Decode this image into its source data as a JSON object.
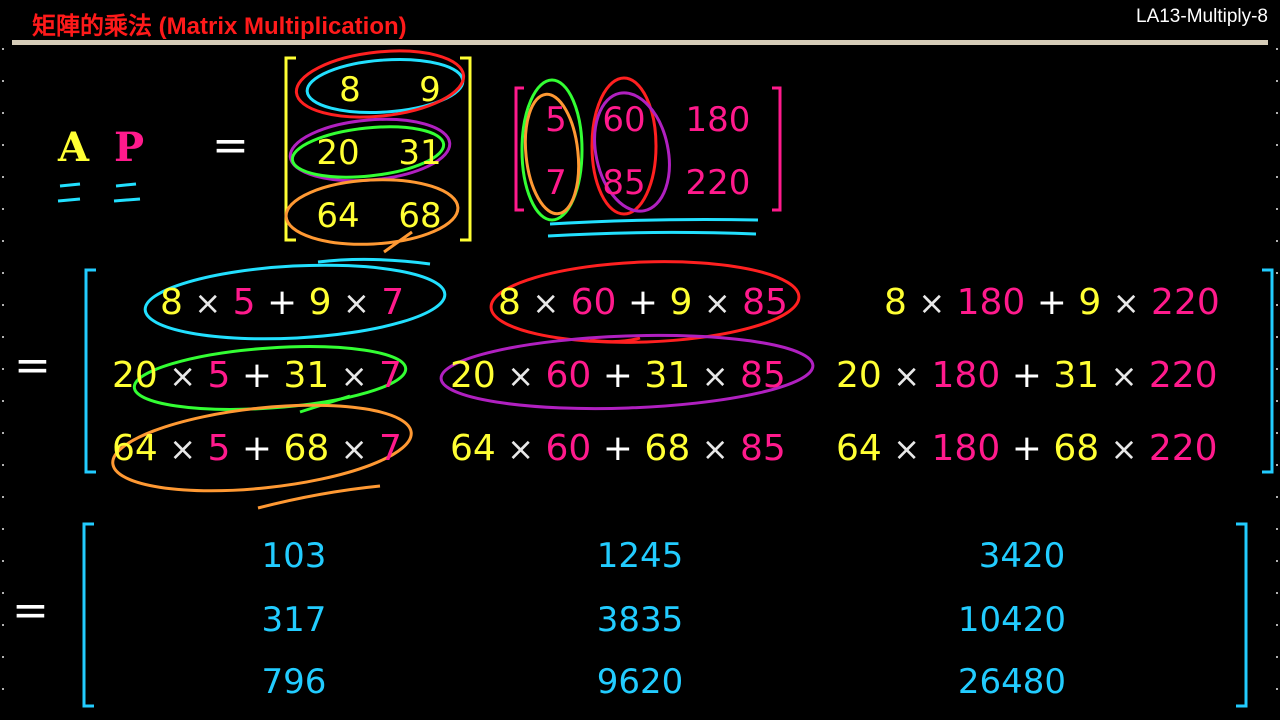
{
  "header": {
    "title": "矩陣的乘法 (Matrix Multiplication)",
    "slide_id": "LA13-Multiply-8"
  },
  "equation": {
    "lhs_a": "A",
    "lhs_p": "P",
    "equals": "="
  },
  "matrix_a": [
    [
      "8",
      "9"
    ],
    [
      "20",
      "31"
    ],
    [
      "64",
      "68"
    ]
  ],
  "matrix_p": [
    [
      "5",
      "60",
      "180"
    ],
    [
      "7",
      "85",
      "220"
    ]
  ],
  "expansion": [
    [
      [
        "8",
        "5",
        "9",
        "7"
      ],
      [
        "8",
        "60",
        "9",
        "85"
      ],
      [
        "8",
        "180",
        "9",
        "220"
      ]
    ],
    [
      [
        "20",
        "5",
        "31",
        "7"
      ],
      [
        "20",
        "60",
        "31",
        "85"
      ],
      [
        "20",
        "180",
        "31",
        "220"
      ]
    ],
    [
      [
        "64",
        "5",
        "68",
        "7"
      ],
      [
        "64",
        "60",
        "68",
        "85"
      ],
      [
        "64",
        "180",
        "68",
        "220"
      ]
    ]
  ],
  "symbols": {
    "times": "×",
    "plus": "+"
  },
  "result": [
    [
      "103",
      "1245",
      "3420"
    ],
    [
      "317",
      "3835",
      "10420"
    ],
    [
      "796",
      "9620",
      "26480"
    ]
  ],
  "colors": {
    "title": "#ff1a1a",
    "matrix_a": "#ffff33",
    "matrix_p": "#ff1a8c",
    "result": "#22ccff",
    "annotation_cyan": "#22e0ff",
    "annotation_red": "#ff2020",
    "annotation_green": "#33ff33",
    "annotation_orange": "#ff9933",
    "annotation_purple": "#b020c0"
  }
}
